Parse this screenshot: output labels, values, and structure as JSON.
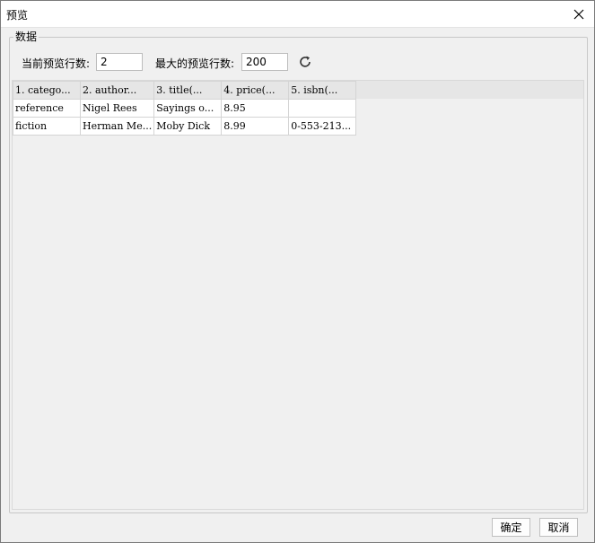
{
  "window": {
    "title": "预览"
  },
  "group": {
    "legend": "数据"
  },
  "controls": {
    "current_label": "当前预览行数:",
    "current_value": "2",
    "max_label": "最大的预览行数:",
    "max_value": "200"
  },
  "table": {
    "columns": [
      "1. catego...",
      "2. author...",
      "3. title(...",
      "4. price(...",
      "5. isbn(..."
    ],
    "rows": [
      [
        "reference",
        "Nigel Rees",
        "Sayings o...",
        "8.95",
        ""
      ],
      [
        "fiction",
        "Herman Me...",
        "Moby Dick",
        "8.99",
        "0-553-213..."
      ]
    ]
  },
  "buttons": {
    "ok": "确定",
    "cancel": "取消"
  },
  "icons": {
    "close": "close-icon",
    "refresh": "refresh-icon"
  }
}
